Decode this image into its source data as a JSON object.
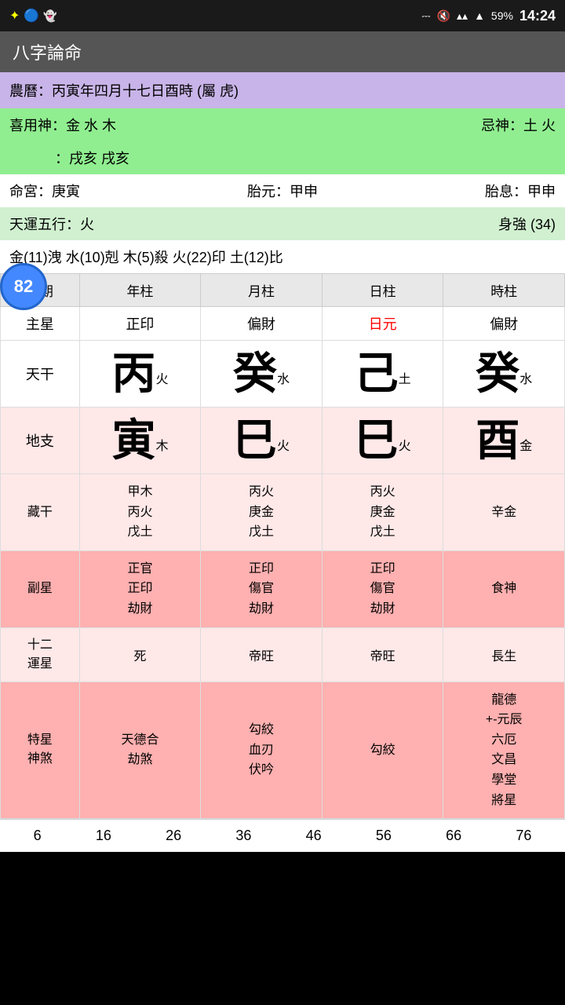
{
  "statusBar": {
    "time": "14:24",
    "battery": "59%",
    "icons": "bluetooth mute wifi signal battery"
  },
  "titleBar": {
    "title": "八字論命"
  },
  "info": {
    "lunarCalendar": "農曆：丙寅年四月十七日酉時 (屬 虎)",
    "favorable": "喜用神：金 水 木",
    "unfavorable": "忌神：土 火",
    "score": "82",
    "nayin": "：戌亥 戌亥",
    "mingGong": "命宮：庚寅",
    "taiYuan": "胎元：甲申",
    "taiXi": "胎息：甲申",
    "tianYun": "天運五行：火",
    "shenQiang": "身強 (34)",
    "fiveElements": "金(11)洩  水(10)剋  木(5)殺  火(22)印  土(12)比"
  },
  "tableHeaders": [
    "日期",
    "年柱",
    "月柱",
    "日柱",
    "時柱"
  ],
  "rows": {
    "zhuXing": {
      "label": "主星",
      "nian": "正印",
      "yue": "偏財",
      "ri": "日元",
      "shi": "偏財",
      "riRed": true
    },
    "tianGan": {
      "label": "天干",
      "nian": {
        "char": "丙",
        "element": "火"
      },
      "yue": {
        "char": "癸",
        "element": "水"
      },
      "ri": {
        "char": "己",
        "element": "土"
      },
      "shi": {
        "char": "癸",
        "element": "水"
      }
    },
    "diZhi": {
      "label": "地支",
      "nian": {
        "char": "寅",
        "element": "木"
      },
      "yue": {
        "char": "巳",
        "element": "火"
      },
      "ri": {
        "char": "巳",
        "element": "火"
      },
      "shi": {
        "char": "酉",
        "element": "金"
      }
    },
    "cangGan": {
      "label": "藏干",
      "nian": "甲木\n丙火\n戊土",
      "yue": "丙火\n庚金\n戊土",
      "ri": "丙火\n庚金\n戊土",
      "shi": "辛金"
    },
    "fuXing": {
      "label": "副星",
      "nian": "正官\n正印\n劫財",
      "yue": "正印\n傷官\n劫財",
      "ri": "正印\n傷官\n劫財",
      "shi": "食神"
    },
    "shiEr": {
      "label": "十二\n運星",
      "nian": "死",
      "yue": "帝旺",
      "ri": "帝旺",
      "shi": "長生"
    },
    "teXing": {
      "label": "特星\n神煞",
      "nian": "天德合\n劫煞",
      "yue": "勾絞\n血刃\n伏吟",
      "ri": "勾絞",
      "shi": "龍德\n+-元辰\n六厄\n文昌\n學堂\n將星"
    }
  },
  "bottomNumbers": [
    "6",
    "16",
    "26",
    "36",
    "46",
    "56",
    "66",
    "76"
  ]
}
